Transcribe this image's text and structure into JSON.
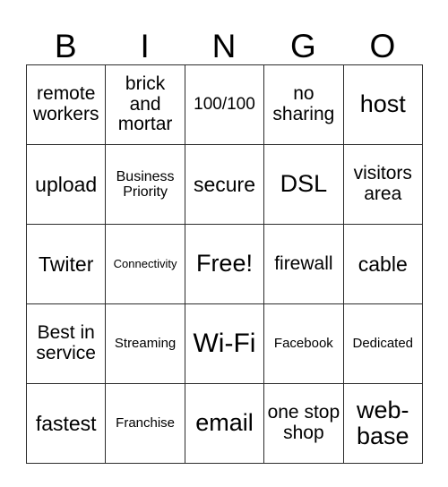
{
  "card": {
    "header_letters": [
      "B",
      "I",
      "N",
      "G",
      "O"
    ],
    "columns": 5,
    "rows": 5,
    "colors": {
      "border": "#2b2b2b",
      "background": "#ffffff",
      "text": "#000000"
    },
    "cells": [
      [
        {
          "text": "remote workers",
          "size": "md2"
        },
        {
          "text": "brick and mortar",
          "size": "md2"
        },
        {
          "text": "100/100",
          "size": "md"
        },
        {
          "text": "no sharing",
          "size": "md2"
        },
        {
          "text": "host",
          "size": "xl"
        }
      ],
      [
        {
          "text": "upload",
          "size": "lg"
        },
        {
          "text": "Business Priority",
          "size": "sm2"
        },
        {
          "text": "secure",
          "size": "lg"
        },
        {
          "text": "DSL",
          "size": "xl"
        },
        {
          "text": "visitors area",
          "size": "md2"
        }
      ],
      [
        {
          "text": "Twiter",
          "size": "lg"
        },
        {
          "text": "Connectivity",
          "size": "xs"
        },
        {
          "text": "Free!",
          "size": "xl"
        },
        {
          "text": "firewall",
          "size": "md2"
        },
        {
          "text": "cable",
          "size": "lg"
        }
      ],
      [
        {
          "text": "Best in service",
          "size": "md2"
        },
        {
          "text": "Streaming",
          "size": "sm"
        },
        {
          "text": "Wi-Fi",
          "size": "xxl"
        },
        {
          "text": "Facebook",
          "size": "sm"
        },
        {
          "text": "Dedicated",
          "size": "sm"
        }
      ],
      [
        {
          "text": "fastest",
          "size": "lg"
        },
        {
          "text": "Franchise",
          "size": "sm"
        },
        {
          "text": "email",
          "size": "xl"
        },
        {
          "text": "one stop shop",
          "size": "md2"
        },
        {
          "text": "web-base",
          "size": "xl"
        }
      ]
    ]
  }
}
